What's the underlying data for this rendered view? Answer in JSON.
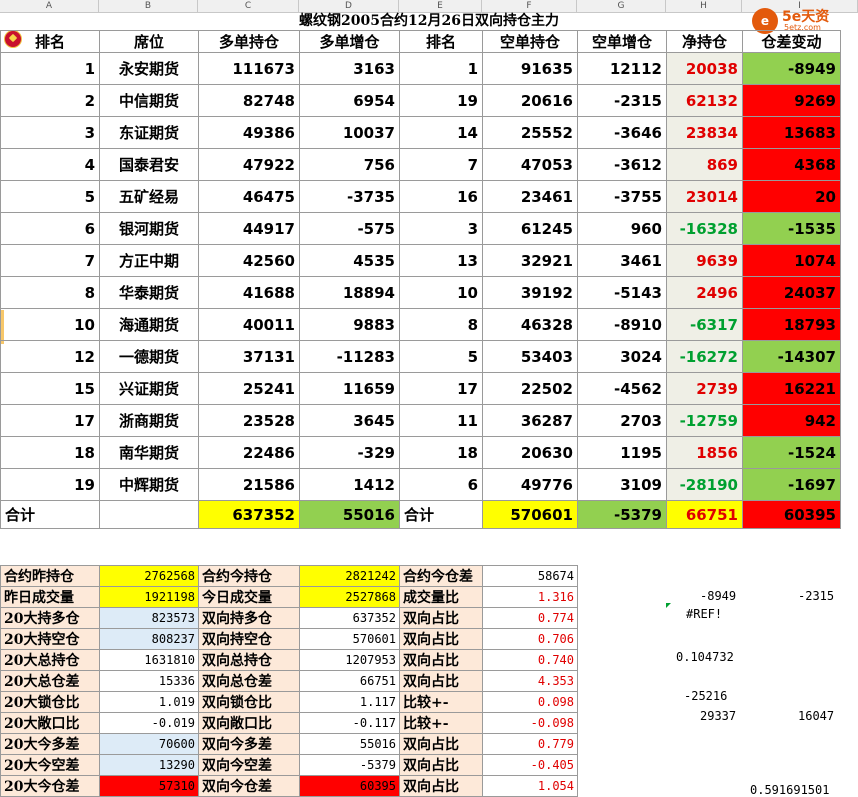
{
  "column_headers": [
    "A",
    "B",
    "C",
    "D",
    "E",
    "F",
    "G",
    "H",
    "I"
  ],
  "title": "螺纹钢2005合约12月26日双向持仓主力",
  "logo": {
    "mark": "e",
    "text": "5e天资",
    "sub": "5etz.com"
  },
  "headers": [
    "排名",
    "席位",
    "多单持仓",
    "多单增仓",
    "排名",
    "空单持仓",
    "空单增仓",
    "净持仓",
    "仓差变动"
  ],
  "rows": [
    {
      "rank": "1",
      "seat": "永安期货",
      "long": "111673",
      "long_chg": "3163",
      "srank": "1",
      "short": "91635",
      "short_chg": "12112",
      "net": "20038",
      "diff": "-8949"
    },
    {
      "rank": "2",
      "seat": "中信期货",
      "long": "82748",
      "long_chg": "6954",
      "srank": "19",
      "short": "20616",
      "short_chg": "-2315",
      "net": "62132",
      "diff": "9269"
    },
    {
      "rank": "3",
      "seat": "东证期货",
      "long": "49386",
      "long_chg": "10037",
      "srank": "14",
      "short": "25552",
      "short_chg": "-3646",
      "net": "23834",
      "diff": "13683"
    },
    {
      "rank": "4",
      "seat": "国泰君安",
      "long": "47922",
      "long_chg": "756",
      "srank": "7",
      "short": "47053",
      "short_chg": "-3612",
      "net": "869",
      "diff": "4368"
    },
    {
      "rank": "5",
      "seat": "五矿经易",
      "long": "46475",
      "long_chg": "-3735",
      "srank": "16",
      "short": "23461",
      "short_chg": "-3755",
      "net": "23014",
      "diff": "20"
    },
    {
      "rank": "6",
      "seat": "银河期货",
      "long": "44917",
      "long_chg": "-575",
      "srank": "3",
      "short": "61245",
      "short_chg": "960",
      "net": "-16328",
      "diff": "-1535"
    },
    {
      "rank": "7",
      "seat": "方正中期",
      "long": "42560",
      "long_chg": "4535",
      "srank": "13",
      "short": "32921",
      "short_chg": "3461",
      "net": "9639",
      "diff": "1074"
    },
    {
      "rank": "8",
      "seat": "华泰期货",
      "long": "41688",
      "long_chg": "18894",
      "srank": "10",
      "short": "39192",
      "short_chg": "-5143",
      "net": "2496",
      "diff": "24037"
    },
    {
      "rank": "10",
      "seat": "海通期货",
      "long": "40011",
      "long_chg": "9883",
      "srank": "8",
      "short": "46328",
      "short_chg": "-8910",
      "net": "-6317",
      "diff": "18793"
    },
    {
      "rank": "12",
      "seat": "一德期货",
      "long": "37131",
      "long_chg": "-11283",
      "srank": "5",
      "short": "53403",
      "short_chg": "3024",
      "net": "-16272",
      "diff": "-14307"
    },
    {
      "rank": "15",
      "seat": "兴证期货",
      "long": "25241",
      "long_chg": "11659",
      "srank": "17",
      "short": "22502",
      "short_chg": "-4562",
      "net": "2739",
      "diff": "16221"
    },
    {
      "rank": "17",
      "seat": "浙商期货",
      "long": "23528",
      "long_chg": "3645",
      "srank": "11",
      "short": "36287",
      "short_chg": "2703",
      "net": "-12759",
      "diff": "942"
    },
    {
      "rank": "18",
      "seat": "南华期货",
      "long": "22486",
      "long_chg": "-329",
      "srank": "18",
      "short": "20630",
      "short_chg": "1195",
      "net": "1856",
      "diff": "-1524"
    },
    {
      "rank": "19",
      "seat": "中辉期货",
      "long": "21586",
      "long_chg": "1412",
      "srank": "6",
      "short": "49776",
      "short_chg": "3109",
      "net": "-28190",
      "diff": "-1697"
    }
  ],
  "total": {
    "label1": "合计",
    "long": "637352",
    "long_chg": "55016",
    "label2": "合计",
    "short": "570601",
    "short_chg": "-5379",
    "net": "66751",
    "diff": "60395"
  },
  "stats": [
    {
      "l1": "合约昨持仓",
      "v1": "2762568",
      "l2": "合约今持仓",
      "v2": "2821242",
      "l3": "合约今仓差",
      "v3": "58674"
    },
    {
      "l1": "昨日成交量",
      "v1": "1921198",
      "l2": "今日成交量",
      "v2": "2527868",
      "l3": "成交量比",
      "v3": "1.316"
    },
    {
      "l1": "20大持多仓",
      "v1": "823573",
      "l2": "双向持多仓",
      "v2": "637352",
      "l3": "双向占比",
      "v3": "0.774"
    },
    {
      "l1": "20大持空仓",
      "v1": "808237",
      "l2": "双向持空仓",
      "v2": "570601",
      "l3": "双向占比",
      "v3": "0.706"
    },
    {
      "l1": "20大总持仓",
      "v1": "1631810",
      "l2": "双向总持仓",
      "v2": "1207953",
      "l3": "双向占比",
      "v3": "0.740"
    },
    {
      "l1": "20大总仓差",
      "v1": "15336",
      "l2": "双向总仓差",
      "v2": "66751",
      "l3": "双向占比",
      "v3": "4.353"
    },
    {
      "l1": "20大锁仓比",
      "v1": "1.019",
      "l2": "双向锁仓比",
      "v2": "1.117",
      "l3": "比较+-",
      "v3": "0.098"
    },
    {
      "l1": "20大敞口比",
      "v1": "-0.019",
      "l2": "双向敞口比",
      "v2": "-0.117",
      "l3": "比较+-",
      "v3": "-0.098"
    },
    {
      "l1": "20大今多差",
      "v1": "70600",
      "l2": "双向今多差",
      "v2": "55016",
      "l3": "双向占比",
      "v3": "0.779"
    },
    {
      "l1": "20大今空差",
      "v1": "13290",
      "l2": "双向今空差",
      "v2": "-5379",
      "l3": "双向占比",
      "v3": "-0.405"
    },
    {
      "l1": "20大今仓差",
      "v1": "57310",
      "l2": "双向今仓差",
      "v2": "60395",
      "l3": "双向占比",
      "v3": "1.054"
    }
  ],
  "extra": {
    "h1": "-8949",
    "i1": "-2315",
    "ref": "#REF!",
    "h_ratio": "0.104732",
    "h_lock": "-25216",
    "h_open": "29337",
    "i_open": "16047",
    "i_last": "0.591691501"
  }
}
